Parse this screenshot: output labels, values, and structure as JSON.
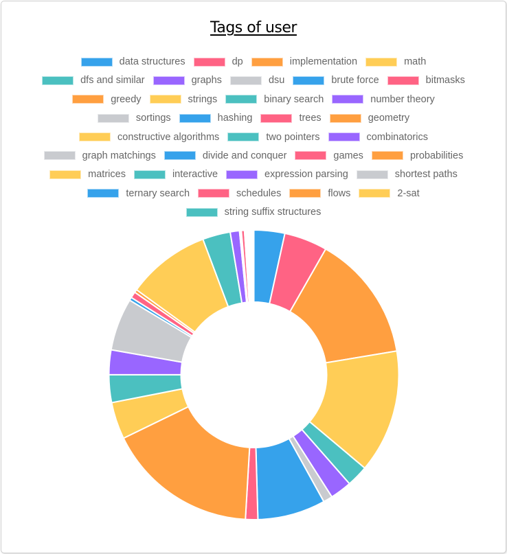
{
  "page": {
    "title": "Tags of user"
  },
  "palette": [
    "#36a2eb",
    "#ff6384",
    "#ff9f40",
    "#ffcd56",
    "#4bc0c0",
    "#9966ff",
    "#c9cbcf"
  ],
  "chart_data": {
    "type": "pie",
    "variant": "doughnut",
    "title": "Tags of user",
    "legend_position": "top",
    "categories": [
      "data structures",
      "dp",
      "implementation",
      "math",
      "dfs and similar",
      "graphs",
      "dsu",
      "brute force",
      "bitmasks",
      "greedy",
      "strings",
      "binary search",
      "number theory",
      "sortings",
      "hashing",
      "trees",
      "geometry",
      "constructive algorithms",
      "two pointers",
      "combinatorics",
      "graph matchings",
      "divide and conquer",
      "games",
      "probabilities",
      "matrices",
      "interactive",
      "expression parsing",
      "shortest paths",
      "ternary search",
      "schedules",
      "flows",
      "2-sat",
      "string suffix structures"
    ],
    "values": [
      10,
      14,
      41,
      40,
      7,
      7,
      3,
      22,
      4,
      49,
      12,
      9,
      8,
      17,
      1,
      2,
      1,
      27,
      9,
      3,
      0.3,
      0.3,
      1,
      0.3,
      0.3,
      0.3,
      0.3,
      0.3,
      0.3,
      0.3,
      0.3,
      0.3,
      0.3
    ],
    "colors": [
      "#36a2eb",
      "#ff6384",
      "#ff9f40",
      "#ffcd56",
      "#4bc0c0",
      "#9966ff",
      "#c9cbcf",
      "#36a2eb",
      "#ff6384",
      "#ff9f40",
      "#ffcd56",
      "#4bc0c0",
      "#9966ff",
      "#c9cbcf",
      "#36a2eb",
      "#ff6384",
      "#ff9f40",
      "#ffcd56",
      "#4bc0c0",
      "#9966ff",
      "#c9cbcf",
      "#36a2eb",
      "#ff6384",
      "#ff9f40",
      "#ffcd56",
      "#4bc0c0",
      "#9966ff",
      "#c9cbcf",
      "#36a2eb",
      "#ff6384",
      "#ff9f40",
      "#ffcd56",
      "#4bc0c0"
    ]
  }
}
